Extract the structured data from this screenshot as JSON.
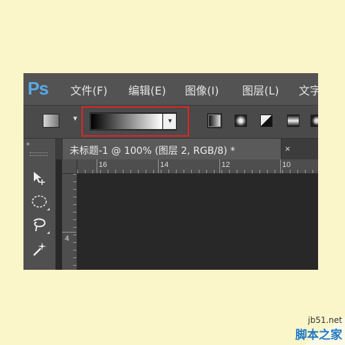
{
  "app": {
    "logo": "Ps"
  },
  "menu": [
    {
      "label": "文件(F)"
    },
    {
      "label": "编辑(E)"
    },
    {
      "label": "图像(I)"
    },
    {
      "label": "图层(L)"
    },
    {
      "label": "文字"
    }
  ],
  "options_bar": {
    "tool_preset_icon": "gradient-tool-preset-icon",
    "gradient_picker": {
      "from_color": "#000000",
      "to_color": "#ffffff",
      "highlight_color": "#e02426"
    },
    "gradient_types": [
      "linear-gradient-icon",
      "radial-gradient-icon",
      "angle-gradient-icon",
      "reflected-gradient-icon",
      "diamond-gradient-icon"
    ],
    "selected_type": "linear-gradient-icon"
  },
  "document": {
    "tab_title": "未标题-1 @ 100% (图层 2, RGB/8) *",
    "close_glyph": "×"
  },
  "rulers": {
    "top_labels": [
      "16",
      "14",
      "12",
      "10"
    ],
    "left_labels": [
      "4"
    ]
  },
  "toolbar": {
    "collapse_glyph": "»",
    "tools": [
      "move-tool-icon",
      "marquee-tool-icon",
      "lasso-tool-icon",
      "magic-wand-tool-icon"
    ]
  },
  "watermark": {
    "site": "jb51.net",
    "name": "脚本之家"
  }
}
